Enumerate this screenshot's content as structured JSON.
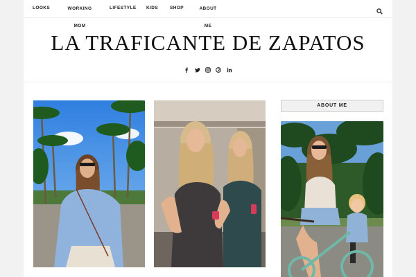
{
  "nav": {
    "items": [
      {
        "label": "LOOKS"
      },
      {
        "label": "WORKING MOM"
      },
      {
        "label": "LIFESTYLE"
      },
      {
        "label": "KIDS"
      },
      {
        "label": "SHOP"
      },
      {
        "label": "ABOUT ME"
      }
    ],
    "search_icon": "search-icon"
  },
  "site": {
    "title": "LA TRAFICANTE DE ZAPATOS",
    "social_icons": [
      "facebook-icon",
      "twitter-icon",
      "instagram-icon",
      "pinterest-icon",
      "linkedin-icon"
    ]
  },
  "sidebar": {
    "title": "ABOUT ME"
  },
  "posts": [
    {
      "image": "photo-woman-palm-trees"
    },
    {
      "image": "photo-two-women-gym"
    }
  ],
  "colors": {
    "page_bg": "#f2f2f2",
    "content_bg": "#ffffff",
    "text": "#222222"
  }
}
